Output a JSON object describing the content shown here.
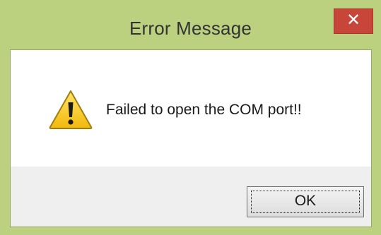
{
  "window": {
    "title": "Error Message",
    "close_glyph": "✕",
    "close_icon": "close-icon"
  },
  "content": {
    "icon": "warning-icon",
    "message": "Failed to open the COM port!!"
  },
  "footer": {
    "ok_label": "OK"
  },
  "colors": {
    "frame": "#bcd180",
    "close_button": "#c8453a",
    "footer_background": "#efefef"
  }
}
